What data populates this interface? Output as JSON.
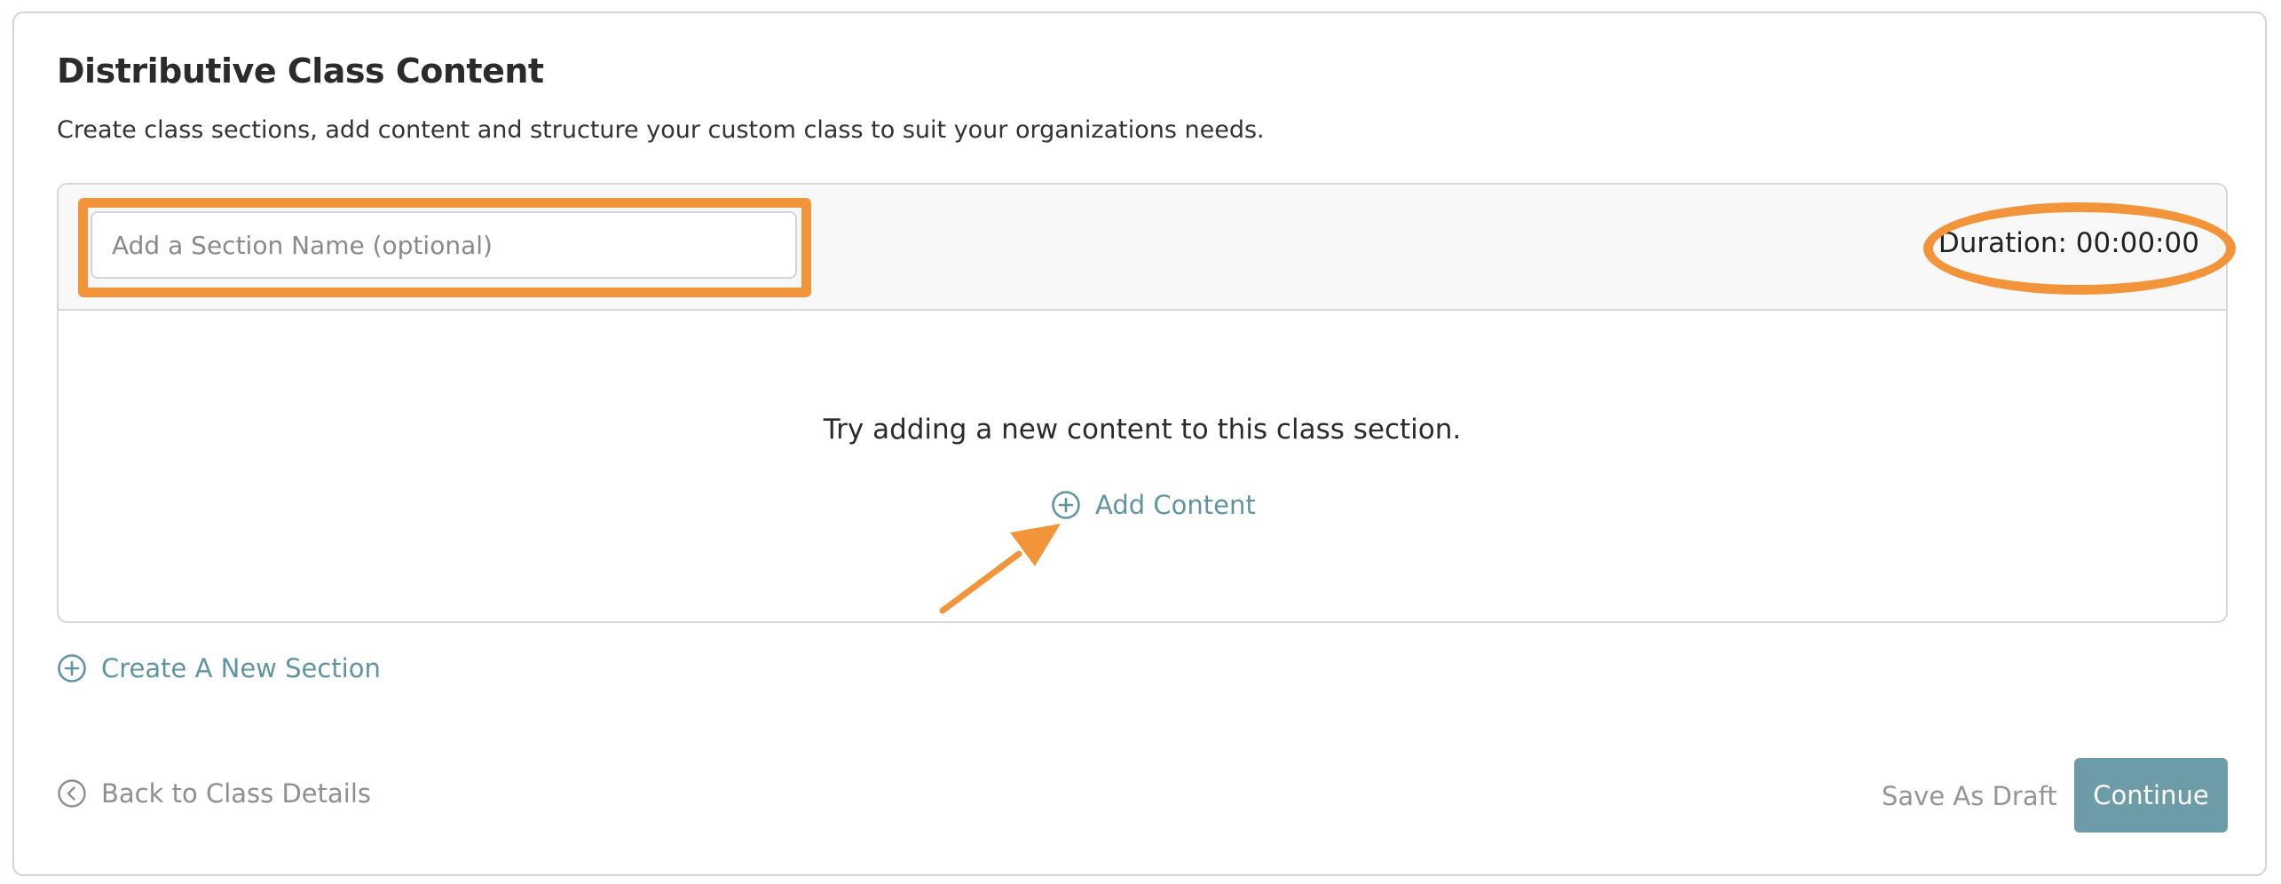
{
  "page": {
    "title": "Distributive Class Content",
    "subtitle": "Create class sections, add content and structure your custom class to suit your organizations needs."
  },
  "section": {
    "name_placeholder": "Add a Section Name (optional)",
    "name_value": "",
    "duration_label": "Duration: 00:00:00",
    "empty_message": "Try adding a new content to this class section.",
    "add_content_label": "Add Content"
  },
  "actions": {
    "create_section_label": "Create A New Section",
    "back_label": "Back to Class Details",
    "save_draft_label": "Save As Draft",
    "continue_label": "Continue"
  },
  "colors": {
    "accent_link": "#5f95a3",
    "primary_button": "#6c9ca8",
    "annotation": "#f2953a"
  },
  "icons": {
    "add_content": "plus-circle-icon",
    "create_section": "plus-circle-icon",
    "back": "chevron-left-circle-icon"
  }
}
